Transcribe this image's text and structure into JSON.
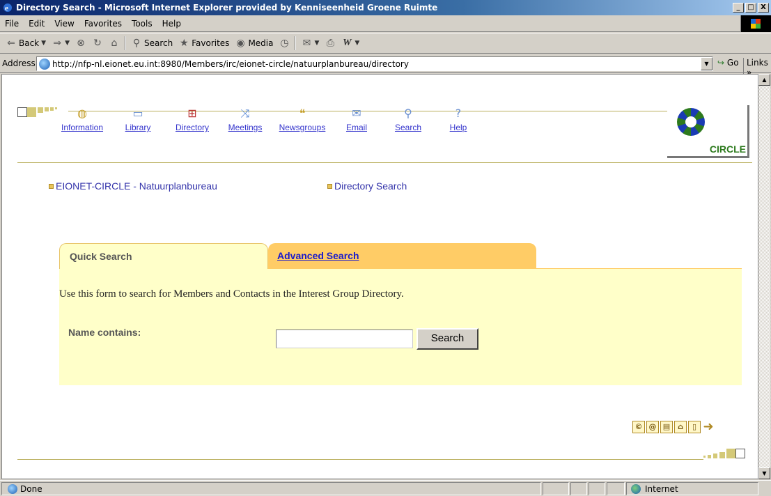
{
  "window": {
    "title": "Directory Search - Microsoft Internet Explorer provided by Kenniseenheid Groene Ruimte",
    "minimize": "_",
    "maximize": "□",
    "close": "X"
  },
  "menu": [
    "File",
    "Edit",
    "View",
    "Favorites",
    "Tools",
    "Help"
  ],
  "toolbar": {
    "back": "Back",
    "search": "Search",
    "favorites": "Favorites",
    "media": "Media"
  },
  "address": {
    "label": "Address",
    "url": "http://nfp-nl.eionet.eu.int:8980/Members/irc/eionet-circle/natuurplanbureau/directory",
    "go": "Go",
    "links": "Links"
  },
  "nav": {
    "items": [
      {
        "label": "Information",
        "icon": "globe-icon"
      },
      {
        "label": "Library",
        "icon": "folder-icon"
      },
      {
        "label": "Directory",
        "icon": "directory-icon"
      },
      {
        "label": "Meetings",
        "icon": "meetings-icon"
      },
      {
        "label": "Newsgroups",
        "icon": "newsgroups-icon"
      },
      {
        "label": "Email",
        "icon": "envelope-icon"
      },
      {
        "label": "Search",
        "icon": "magnifier-icon"
      },
      {
        "label": "Help",
        "icon": "question-icon"
      }
    ]
  },
  "logo": {
    "text": "CIRCLE"
  },
  "breadcrumbs": {
    "group": "EIONET-CIRCLE - Natuurplanbureau",
    "page": "Directory Search"
  },
  "tabs": {
    "quick": "Quick Search",
    "advanced": "Advanced Search"
  },
  "form": {
    "description": "Use this form to search for Members and Contacts in the Interest Group Directory.",
    "name_label": "Name contains:",
    "name_value": "",
    "search_button": "Search"
  },
  "status": {
    "text": "Done",
    "zone": "Internet"
  },
  "colors": {
    "panel": "#ffffc9",
    "tab_active": "#ffcc66",
    "link": "#3333cc",
    "rule": "#b9ae5a"
  }
}
